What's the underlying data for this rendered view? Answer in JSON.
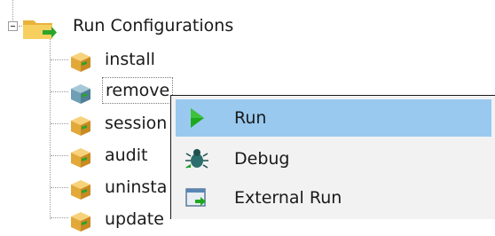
{
  "tree": {
    "root": {
      "label": "Run Configurations",
      "icon": "folder-run-icon"
    },
    "items": [
      {
        "label": "install",
        "icon": "package-icon"
      },
      {
        "label": "remove",
        "icon": "package-blue-icon",
        "selected": true
      },
      {
        "label": "session",
        "icon": "package-icon"
      },
      {
        "label": "audit",
        "icon": "package-icon"
      },
      {
        "label": "uninsta",
        "icon": "package-icon"
      },
      {
        "label": "update",
        "icon": "package-icon"
      }
    ]
  },
  "context_menu": {
    "items": [
      {
        "label": "Run",
        "icon": "play-icon",
        "highlighted": true
      },
      {
        "label": "Debug",
        "icon": "bug-icon"
      },
      {
        "label": "External Run",
        "icon": "external-run-icon"
      }
    ]
  },
  "colors": {
    "highlight": "#99c9ef",
    "menu_bg": "#f2f2f2",
    "run_green": "#1fa81f",
    "folder_yellow": "#f3c34a"
  }
}
